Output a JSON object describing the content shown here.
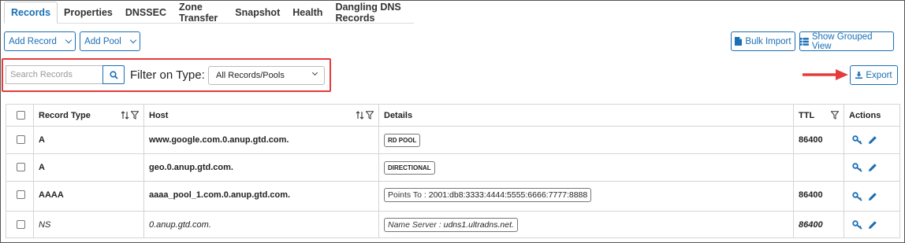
{
  "tabs": [
    {
      "label": "Records",
      "active": true
    },
    {
      "label": "Properties"
    },
    {
      "label": "DNSSEC"
    },
    {
      "label": "Zone Transfer"
    },
    {
      "label": "Snapshot"
    },
    {
      "label": "Health"
    },
    {
      "label": "Dangling DNS Records"
    }
  ],
  "toolbar": {
    "add_record_label": "Add Record",
    "add_pool_label": "Add Pool",
    "bulk_import_label": "Bulk Import",
    "grouped_view_label": "Show Grouped View",
    "export_label": "Export"
  },
  "search": {
    "placeholder": "Search Records",
    "value": ""
  },
  "filter": {
    "label": "Filter on Type:",
    "selected": "All Records/Pools"
  },
  "table": {
    "headers": {
      "type": "Record Type",
      "host": "Host",
      "details": "Details",
      "ttl": "TTL",
      "actions": "Actions"
    },
    "rows": [
      {
        "type": "A",
        "host": "www.google.com.0.anup.gtd.com.",
        "detail_badge": "RD POOL",
        "ttl": "86400"
      },
      {
        "type": "A",
        "host": "geo.0.anup.gtd.com.",
        "detail_badge": "DIRECTIONAL",
        "ttl": ""
      },
      {
        "type": "AAAA",
        "host": "aaaa_pool_1.com.0.anup.gtd.com.",
        "detail_prefix": "Points To : ",
        "detail_value": "2001:db8:3333:4444:5555:6666:7777:8888",
        "ttl": "86400"
      },
      {
        "type": "NS",
        "host": "0.anup.gtd.com.",
        "detail_prefix": "Name Server : ",
        "detail_value": "udns1.ultradns.net.",
        "ttl": "86400"
      }
    ]
  },
  "colors": {
    "accent": "#1a6fb5",
    "highlight": "#e53b3b",
    "arrow": "#e53b3b"
  },
  "icons": [
    "search-icon",
    "file-icon",
    "list-icon",
    "download-icon",
    "sort-icon",
    "filter-icon",
    "key-icon",
    "pencil-icon",
    "chevron-down-icon",
    "arrow-right-icon"
  ]
}
